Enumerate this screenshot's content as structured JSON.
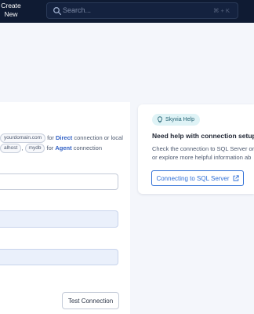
{
  "topbar": {
    "create_new": "Create\nNew",
    "search_placeholder": "Search...",
    "search_shortcut": "⌘ + K"
  },
  "form": {
    "helper_chip_1": "yourdomain.com",
    "helper_text_1": " for ",
    "helper_direct": "Direct",
    "helper_text_2": " connection or local",
    "helper_chip_2": "alhost",
    "helper_sep": ",",
    "helper_chip_3": "mydb",
    "helper_text_3": " for ",
    "helper_agent": "Agent",
    "helper_text_4": " connection",
    "test_connection_label": "Test Connection"
  },
  "help": {
    "badge": "Skyvia Help",
    "title": "Need help with connection setup?",
    "text": "Check the connection to SQL Server or\nor explore more helpful information ab",
    "button_label": "Connecting to SQL Server"
  }
}
